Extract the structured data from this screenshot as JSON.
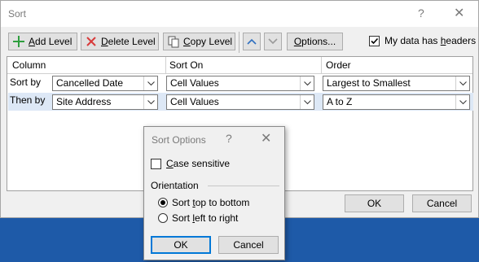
{
  "window": {
    "title": "Sort",
    "help_glyph": "?",
    "close_glyph": "✕"
  },
  "toolbar": {
    "add_level": {
      "label_pre": "",
      "hotkey": "A",
      "label_post": "dd Level"
    },
    "delete_level": {
      "label_pre": "",
      "hotkey": "D",
      "label_post": "elete Level"
    },
    "copy_level": {
      "label_pre": "",
      "hotkey": "C",
      "label_post": "opy Level"
    },
    "options": {
      "label_pre": "",
      "hotkey": "O",
      "label_post": "ptions..."
    },
    "my_data_has_headers": {
      "label_pre": "My data has ",
      "hotkey": "h",
      "label_post": "eaders",
      "checked": true
    }
  },
  "grid": {
    "headers": {
      "column": "Column",
      "sort_on": "Sort On",
      "order": "Order"
    },
    "rows": [
      {
        "label": "Sort by",
        "column": "Cancelled Date",
        "sort_on": "Cell Values",
        "order": "Largest to Smallest"
      },
      {
        "label": "Then by",
        "column": "Site Address",
        "sort_on": "Cell Values",
        "order": "A to Z"
      }
    ]
  },
  "buttons": {
    "ok": "OK",
    "cancel": "Cancel"
  },
  "sort_options": {
    "title": "Sort Options",
    "help_glyph": "?",
    "close_glyph": "✕",
    "case_sensitive": {
      "hotkey": "C",
      "label_post": "ase sensitive",
      "checked": false
    },
    "orientation_label": "Orientation",
    "top_to_bottom": {
      "label_pre": "Sort ",
      "hotkey": "t",
      "label_post": "op to bottom",
      "selected": true
    },
    "left_to_right": {
      "label_pre": "Sort ",
      "hotkey": "l",
      "label_post": "eft to right",
      "selected": false
    },
    "ok": "OK",
    "cancel": "Cancel"
  },
  "colors": {
    "accent_blue": "#0078d7",
    "desktop_blue": "#1e5aa8",
    "add_green": "#2e9e3e",
    "delete_red": "#d83b3b"
  }
}
